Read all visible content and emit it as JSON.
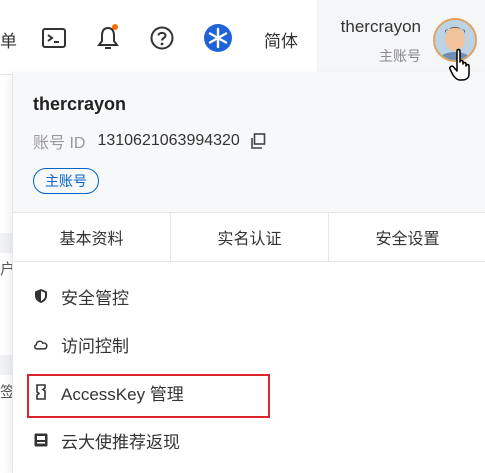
{
  "topbar": {
    "left_partial_text": "单",
    "language": "简体",
    "user": {
      "name": "thercrayon",
      "role": "主账号"
    }
  },
  "background": {
    "partial_char_1": "户",
    "partial_char_2": "签"
  },
  "panel": {
    "username": "thercrayon",
    "account_id_label": "账号 ID",
    "account_id": "1310621063994320",
    "badge": "主账号",
    "tabs": [
      {
        "label": "基本资料"
      },
      {
        "label": "实名认证"
      },
      {
        "label": "安全设置"
      }
    ],
    "menu": [
      {
        "label": "安全管控",
        "icon": "shield-icon"
      },
      {
        "label": "访问控制",
        "icon": "cloud-icon"
      },
      {
        "label": "AccessKey 管理",
        "icon": "key-icon"
      },
      {
        "label": "云大使推荐返现",
        "icon": "gift-icon"
      }
    ]
  },
  "colors": {
    "accent_blue": "#0064c8",
    "highlight_red": "#d9262b",
    "notification_orange": "#ff6a00"
  }
}
